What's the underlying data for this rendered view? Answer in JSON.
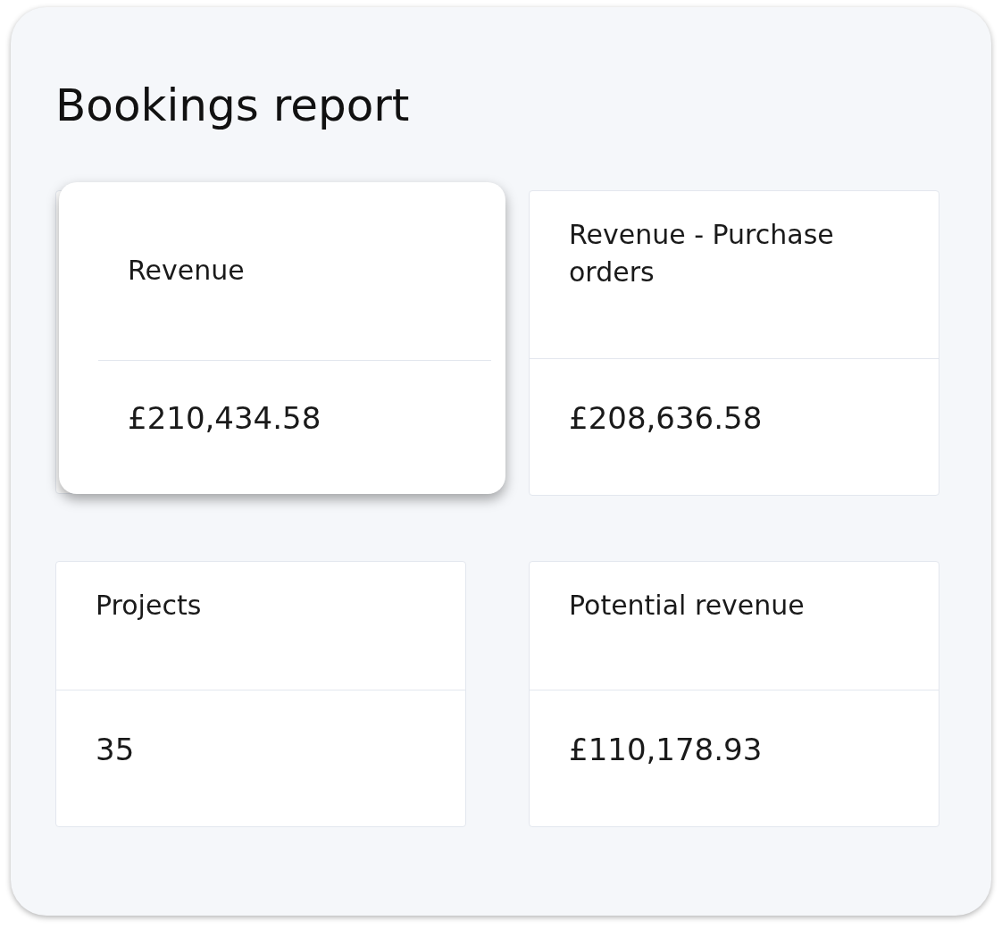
{
  "title": "Bookings report",
  "cards": [
    {
      "label": "Revenue",
      "value": "£210,434.58",
      "raised": true
    },
    {
      "label": "Revenue - Purchase orders",
      "value": "£208,636.58",
      "raised": false
    },
    {
      "label": "Projects",
      "value": "35",
      "raised": false
    },
    {
      "label": "Potential revenue",
      "value": "£110,178.93",
      "raised": false
    }
  ]
}
